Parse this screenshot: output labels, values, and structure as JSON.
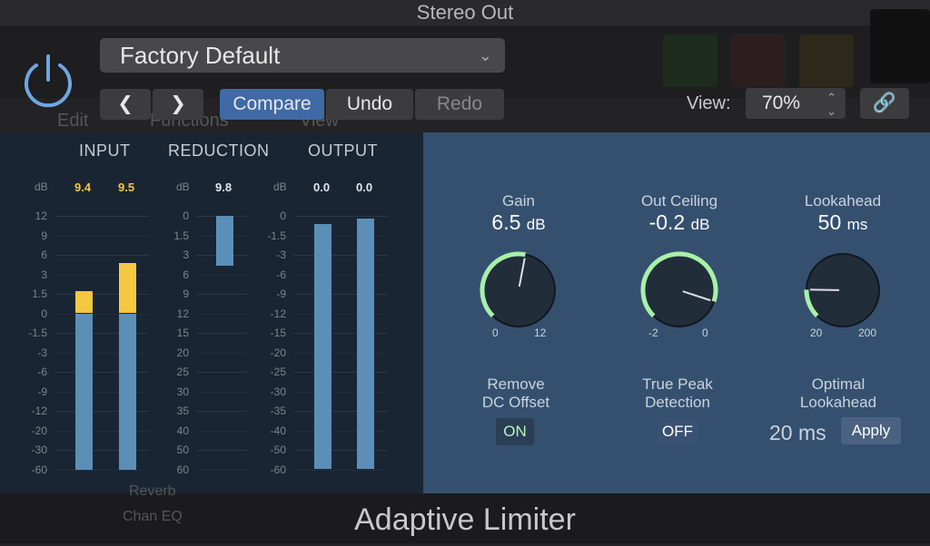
{
  "window": {
    "title": "Stereo Out"
  },
  "background": {
    "menu_items": [
      "Edit",
      "Functions",
      "View"
    ],
    "channel_items": [
      "Reverb",
      "Chan EQ"
    ]
  },
  "header": {
    "preset": "Factory Default",
    "compare": "Compare",
    "undo": "Undo",
    "redo": "Redo",
    "view_label": "View:",
    "view_value": "70%",
    "accent": "#3f6aa5"
  },
  "meters": {
    "input": {
      "label": "INPUT",
      "unit": "dB",
      "ticks": [
        "12",
        "9",
        "6",
        "3",
        "1.5",
        "0",
        "-1.5",
        "-3",
        "-6",
        "-9",
        "-12",
        "-20",
        "-30",
        "-60"
      ],
      "readouts": [
        "9.4",
        "9.5"
      ],
      "levels_db": [
        1.7,
        4.7
      ]
    },
    "reduction": {
      "label": "REDUCTION",
      "unit": "dB",
      "ticks": [
        "0",
        "1.5",
        "3",
        "6",
        "9",
        "12",
        "15",
        "20",
        "25",
        "30",
        "35",
        "40",
        "50",
        "60"
      ],
      "readouts": [
        "9.8"
      ],
      "levels_db": [
        4.7
      ]
    },
    "output": {
      "label": "OUTPUT",
      "unit": "dB",
      "ticks": [
        "0",
        "-1.5",
        "-3",
        "-6",
        "-9",
        "-12",
        "-15",
        "-20",
        "-25",
        "-30",
        "-35",
        "-40",
        "-50",
        "-60"
      ],
      "readouts": [
        "0.0",
        "0.0"
      ],
      "levels_db": [
        -0.6,
        -0.2
      ]
    },
    "colors": {
      "bar": "#5b8fb8",
      "over": "#f5c842"
    }
  },
  "controls": {
    "gain": {
      "label": "Gain",
      "value": "6.5",
      "unit": "dB",
      "min": "0",
      "max": "12",
      "fraction": 0.54
    },
    "ceiling": {
      "label": "Out Ceiling",
      "value": "-0.2",
      "unit": "dB",
      "min": "-2",
      "max": "0",
      "fraction": 0.9
    },
    "lookahead": {
      "label": "Lookahead",
      "value": "50",
      "unit": "ms",
      "min": "20",
      "max": "200",
      "fraction": 0.17
    },
    "dc": {
      "label1": "Remove",
      "label2": "DC Offset",
      "state": "ON"
    },
    "truepeak": {
      "label1": "True Peak",
      "label2": "Detection",
      "state": "OFF"
    },
    "optimal": {
      "label1": "Optimal",
      "label2": "Lookahead",
      "value": "20 ms",
      "apply": "Apply"
    },
    "knob_color": "#a8f0a8"
  },
  "footer": {
    "title": "Adaptive Limiter"
  }
}
